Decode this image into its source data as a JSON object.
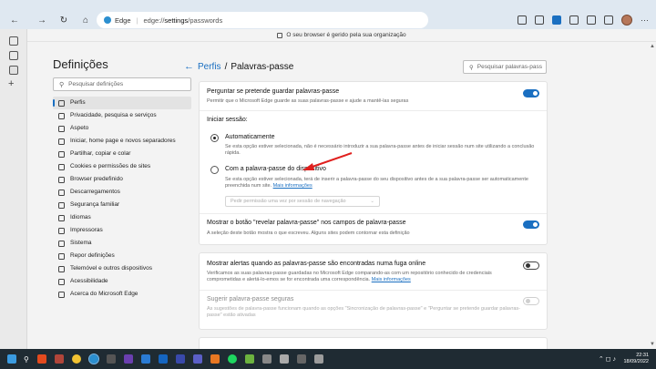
{
  "browser": {
    "brand": "Edge",
    "url_host": "edge://",
    "url_path": "settings",
    "url_rest": "/passwords",
    "managed_notice": "O seu browser é gerido pela sua organização"
  },
  "sidebar": {
    "title": "Definições",
    "search_placeholder": "Pesquisar definições",
    "items": [
      {
        "label": "Perfis",
        "selected": true
      },
      {
        "label": "Privacidade, pesquisa e serviços"
      },
      {
        "label": "Aspeto"
      },
      {
        "label": "Iniciar, home page e novos separadores"
      },
      {
        "label": "Partilhar, copiar e colar"
      },
      {
        "label": "Cookies e permissões de sites"
      },
      {
        "label": "Browser predefinido"
      },
      {
        "label": "Descarregamentos"
      },
      {
        "label": "Segurança familiar"
      },
      {
        "label": "Idiomas"
      },
      {
        "label": "Impressoras"
      },
      {
        "label": "Sistema"
      },
      {
        "label": "Repor definições"
      },
      {
        "label": "Telemóvel e outros dispositivos"
      },
      {
        "label": "Acessibilidade"
      },
      {
        "label": "Acerca do Microsoft Edge"
      }
    ]
  },
  "main": {
    "crumb_parent": "Perfis",
    "crumb_sep": "/",
    "crumb_current": "Palavras-passe",
    "search_placeholder": "Pesquisar palavras-pass",
    "offer_save": {
      "title": "Perguntar se pretende guardar palavras-passe",
      "desc": "Permitir que o Microsoft Edge guarde as suas palavras-passe e ajude a mantê-las seguras",
      "enabled": true
    },
    "signin_label": "Iniciar sessão:",
    "auto": {
      "title": "Automaticamente",
      "desc1": "Se esta opção estiver selecionada, não é necessário introduzir a sua palavra-passe antes de iniciar sessão num site utilizando a conclusão",
      "desc2": "rápida."
    },
    "device_pw": {
      "title": "Com a palavra-passe do dispositivo",
      "desc1": "Se esta opção estiver selecionada, terá de inserir a palavra-passe do seu dispositivo antes de a sua palavra-passe ser automaticamente",
      "desc2": "preenchida num site.",
      "more": "Mais informações",
      "select": "Pedir permissão uma vez por sessão de navegação"
    },
    "reveal": {
      "title": "Mostrar o botão \"revelar palavra-passe\" nos campos de palavra-passe",
      "desc": "A seleção deste botão mostra o que escreveu. Alguns sites podem contornar esta definição",
      "enabled": true
    },
    "leak": {
      "title": "Mostrar alertas quando as palavras-passe são encontradas numa fuga online",
      "desc1": "Verificamos as suas palavras-passe guardadas no Microsoft Edge comparando-as com um repositório conhecido de credenciais",
      "desc2": "comprometidas e alertá-lo-emos se for encontrada uma correspondência.",
      "more": "Mais informações",
      "enabled": false
    },
    "suggest": {
      "title": "Sugerir palavra-passe seguras",
      "desc1": "As sugestões de palavra-passe funcionam quando as opções \"Sincronização de palavras-passe\" e \"Perguntar se pretende guardar palavras-",
      "desc2": "passe\" estão ativadas",
      "enabled": false
    }
  },
  "taskbar": {
    "time": "22:31",
    "date": "18/09/2022"
  },
  "colors": {
    "accent": "#1a6fc1",
    "arrow": "#e0201e"
  }
}
